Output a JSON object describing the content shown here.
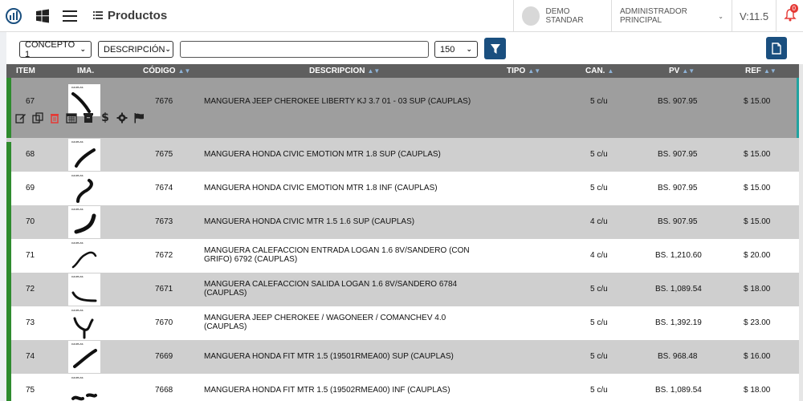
{
  "header": {
    "title": "Productos",
    "company": "DEMO STANDAR",
    "user": "ADMINISTRADOR PRINCIPAL",
    "version": "V:11.5",
    "notifications": "0"
  },
  "filters": {
    "concept": "CONCEPTO 1",
    "field": "DESCRIPCIÓN",
    "search_value": "",
    "page_size": "150"
  },
  "table": {
    "headers": {
      "item": "ITEM",
      "image": "IMA.",
      "code": "CÓDIGO",
      "description": "DESCRIPCION",
      "type": "TIPO",
      "qty": "CAN.",
      "pv": "PV",
      "ref": "REF"
    },
    "rows": [
      {
        "item": "67",
        "code": "7676",
        "description": "MANGUERA JEEP CHEROKEE LIBERTY KJ 3.7 01 - 03 SUP (CAUPLAS)",
        "qty": "5 c/u",
        "pv": "BS. 907.95",
        "ref": "$ 15.00"
      },
      {
        "item": "68",
        "code": "7675",
        "description": "MANGUERA HONDA CIVIC EMOTION MTR 1.8 SUP (CAUPLAS)",
        "qty": "5 c/u",
        "pv": "BS. 907.95",
        "ref": "$ 15.00"
      },
      {
        "item": "69",
        "code": "7674",
        "description": "MANGUERA HONDA CIVIC EMOTION MTR 1.8 INF (CAUPLAS)",
        "qty": "5 c/u",
        "pv": "BS. 907.95",
        "ref": "$ 15.00"
      },
      {
        "item": "70",
        "code": "7673",
        "description": "MANGUERA HONDA CIVIC MTR 1.5 1.6 SUP (CAUPLAS)",
        "qty": "4 c/u",
        "pv": "BS. 907.95",
        "ref": "$ 15.00"
      },
      {
        "item": "71",
        "code": "7672",
        "description": "MANGUERA CALEFACCION ENTRADA LOGAN 1.6 8V/SANDERO (CON GRIFO) 6792 (CAUPLAS)",
        "qty": "4 c/u",
        "pv": "BS. 1,210.60",
        "ref": "$ 20.00"
      },
      {
        "item": "72",
        "code": "7671",
        "description": "MANGUERA CALEFACCION SALIDA LOGAN 1.6 8V/SANDERO 6784 (CAUPLAS)",
        "qty": "5 c/u",
        "pv": "BS. 1,089.54",
        "ref": "$ 18.00"
      },
      {
        "item": "73",
        "code": "7670",
        "description": "MANGUERA JEEP CHEROKEE / WAGONEER / COMANCHEV 4.0 (CAUPLAS)",
        "qty": "5 c/u",
        "pv": "BS. 1,392.19",
        "ref": "$ 23.00"
      },
      {
        "item": "74",
        "code": "7669",
        "description": "MANGUERA HONDA FIT MTR 1.5 (19501RMEA00) SUP (CAUPLAS)",
        "qty": "5 c/u",
        "pv": "BS. 968.48",
        "ref": "$ 16.00"
      },
      {
        "item": "75",
        "code": "7668",
        "description": "MANGUERA HONDA FIT MTR 1.5 (19502RMEA00) INF (CAUPLAS)",
        "qty": "5 c/u",
        "pv": "BS. 1,089.54",
        "ref": "$ 18.00"
      }
    ]
  },
  "colors": {
    "primary": "#1a4f7f",
    "header_bg": "#5f5f5f",
    "selected_row": "#9e9e9e",
    "striped_row": "#cfcfcf",
    "status_green": "#2e8b2e",
    "delete_red": "#e53935"
  }
}
